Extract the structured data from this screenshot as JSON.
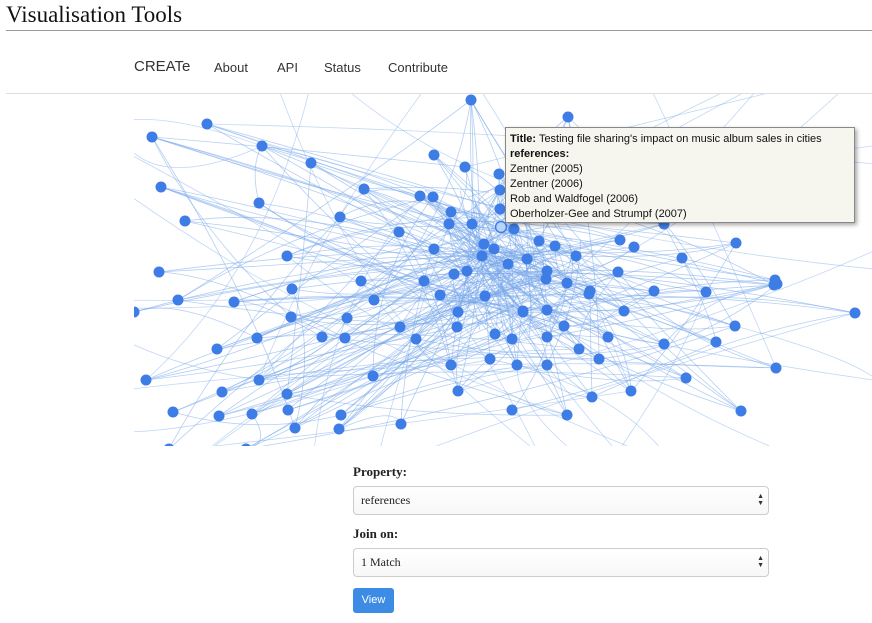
{
  "page": {
    "title": "Visualisation Tools"
  },
  "nav": {
    "brand": "CREATe",
    "links": [
      "About",
      "API",
      "Status",
      "Contribute"
    ]
  },
  "colors": {
    "node": "#3f7de6",
    "edge": "#78a8ea",
    "button": "#3c8ce6",
    "tooltip_bg": "#f6f6ef"
  },
  "tooltip": {
    "title_label": "Title:",
    "title_value": "Testing file sharing's impact on music album sales in cities",
    "refs_label": "references:",
    "refs": [
      "Zentner (2005)",
      "Zentner (2006)",
      "Rob and Waldfogel (2006)",
      "Oberholzer-Gee and Strumpf (2007)"
    ]
  },
  "form": {
    "property_label": "Property:",
    "property_value": "references",
    "join_label": "Join on:",
    "join_value": "1 Match",
    "view_button": "View"
  },
  "icons": {
    "select_arrows": "updown-arrows-icon"
  }
}
